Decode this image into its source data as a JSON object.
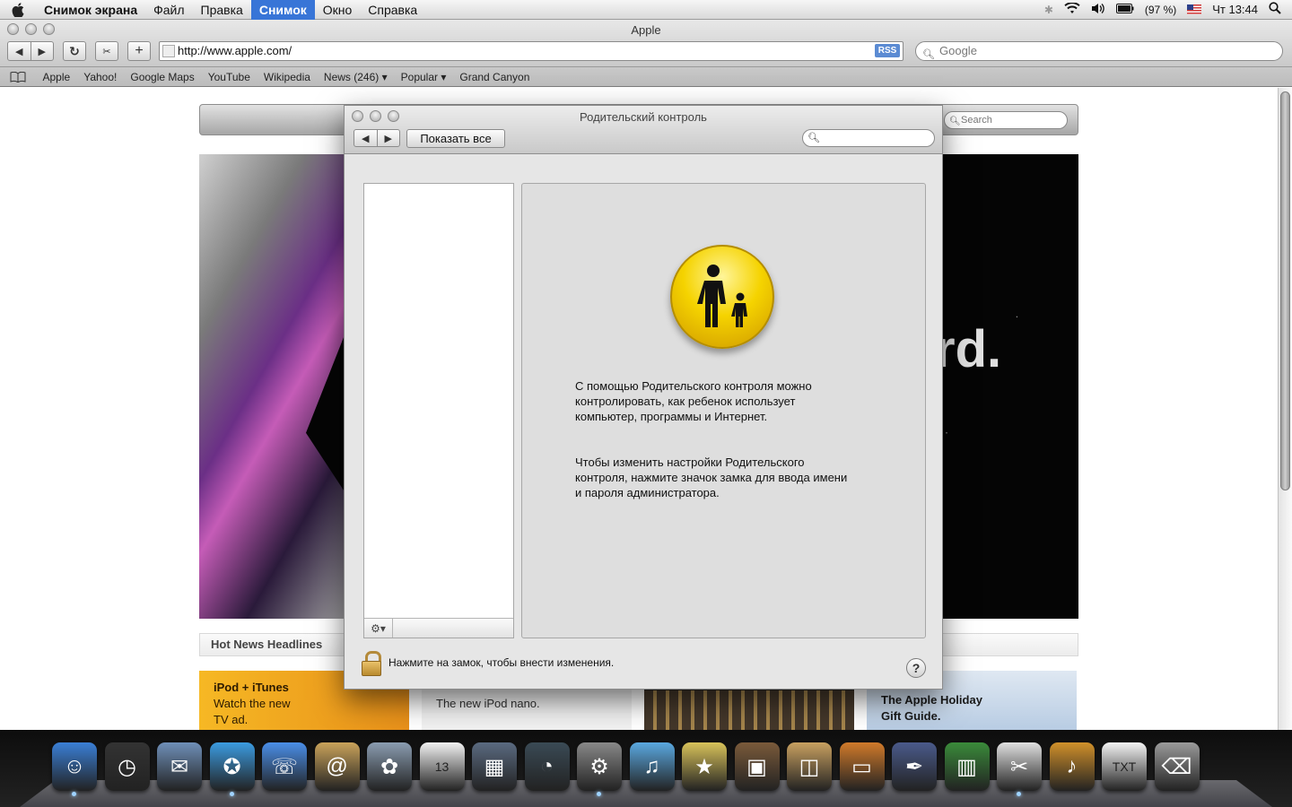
{
  "menubar": {
    "items": [
      {
        "label": "Снимок экрана",
        "bold": true
      },
      {
        "label": "Файл"
      },
      {
        "label": "Правка"
      },
      {
        "label": "Снимок",
        "active": true
      },
      {
        "label": "Окно"
      },
      {
        "label": "Справка"
      }
    ],
    "battery": "(97 %)",
    "clock": "Чт 13:44"
  },
  "safari": {
    "title": "Apple",
    "url": "http://www.apple.com/",
    "rss_label": "RSS",
    "search_placeholder": "Google",
    "bookmarks": [
      "Apple",
      "Yahoo!",
      "Google Maps",
      "YouTube",
      "Wikipedia",
      "News (246) ▾",
      "Popular ▾",
      "Grand Canyon"
    ]
  },
  "webpage": {
    "search_placeholder": "Search",
    "hero_text": "rd.",
    "hot_news": "Hot News Headlines",
    "promos": {
      "p1_line1": "iPod + iTunes",
      "p1_line2": "Watch the new",
      "p1_line3": "TV ad.",
      "p2_line1": "The new iPod nano.",
      "p4_line1": "The Apple Holiday",
      "p4_line2": "Gift Guide."
    }
  },
  "dialog": {
    "title": "Родительский контроль",
    "show_all": "Показать все",
    "desc1": "С помощью Родительского контроля можно\nконтролировать, как ребенок использует\nкомпьютер, программы и Интернет.",
    "desc2": "Чтобы изменить настройки Родительского\nконтроля, нажмите значок замка для ввода имени\nи пароля администратора.",
    "lock_text": "Нажмите на замок, чтобы внести изменения.",
    "help_label": "?"
  },
  "dock": {
    "icons": [
      {
        "name": "finder-icon",
        "glyph": "☺",
        "color": "#3a7fd6",
        "running": true
      },
      {
        "name": "dashboard-icon",
        "glyph": "◷",
        "color": "#333333"
      },
      {
        "name": "mail-icon",
        "glyph": "✉",
        "color": "#6f8fb8"
      },
      {
        "name": "safari-icon",
        "glyph": "✪",
        "color": "#3b9be0",
        "running": true
      },
      {
        "name": "ichat-icon",
        "glyph": "☏",
        "color": "#4a8ee8"
      },
      {
        "name": "address-book-icon",
        "glyph": "@",
        "color": "#c9a25a"
      },
      {
        "name": "iphoto-preview-icon",
        "glyph": "✿",
        "color": "#8a9cb0"
      },
      {
        "name": "ical-icon",
        "glyph": "13",
        "color": "#f2f2f2"
      },
      {
        "name": "spaces-icon",
        "glyph": "▦",
        "color": "#5a6a80"
      },
      {
        "name": "time-machine-icon",
        "glyph": "◔",
        "color": "#3a4a55"
      },
      {
        "name": "system-preferences-icon",
        "glyph": "⚙",
        "color": "#888888",
        "running": true
      },
      {
        "name": "itunes-icon",
        "glyph": "♫",
        "color": "#5aa8e0"
      },
      {
        "name": "imovie-icon",
        "glyph": "★",
        "color": "#d8c25a"
      },
      {
        "name": "iphoto-icon",
        "glyph": "▣",
        "color": "#7a5a3a"
      },
      {
        "name": "iweb-icon",
        "glyph": "◫",
        "color": "#c8a060"
      },
      {
        "name": "keynote-icon",
        "glyph": "▭",
        "color": "#d07a2a"
      },
      {
        "name": "quill-icon",
        "glyph": "✒",
        "color": "#4a5a8a"
      },
      {
        "name": "numbers-icon",
        "glyph": "▥",
        "color": "#3a8a3a"
      },
      {
        "name": "grab-icon",
        "glyph": "✂",
        "color": "#e0e0e0",
        "running": true
      },
      {
        "name": "garageband-icon",
        "glyph": "♪",
        "color": "#d0902a"
      },
      {
        "name": "text-file-icon",
        "glyph": "TXT",
        "color": "#f4f4f4"
      },
      {
        "name": "trash-icon",
        "glyph": "⌫",
        "color": "#9a9a9a"
      }
    ]
  }
}
